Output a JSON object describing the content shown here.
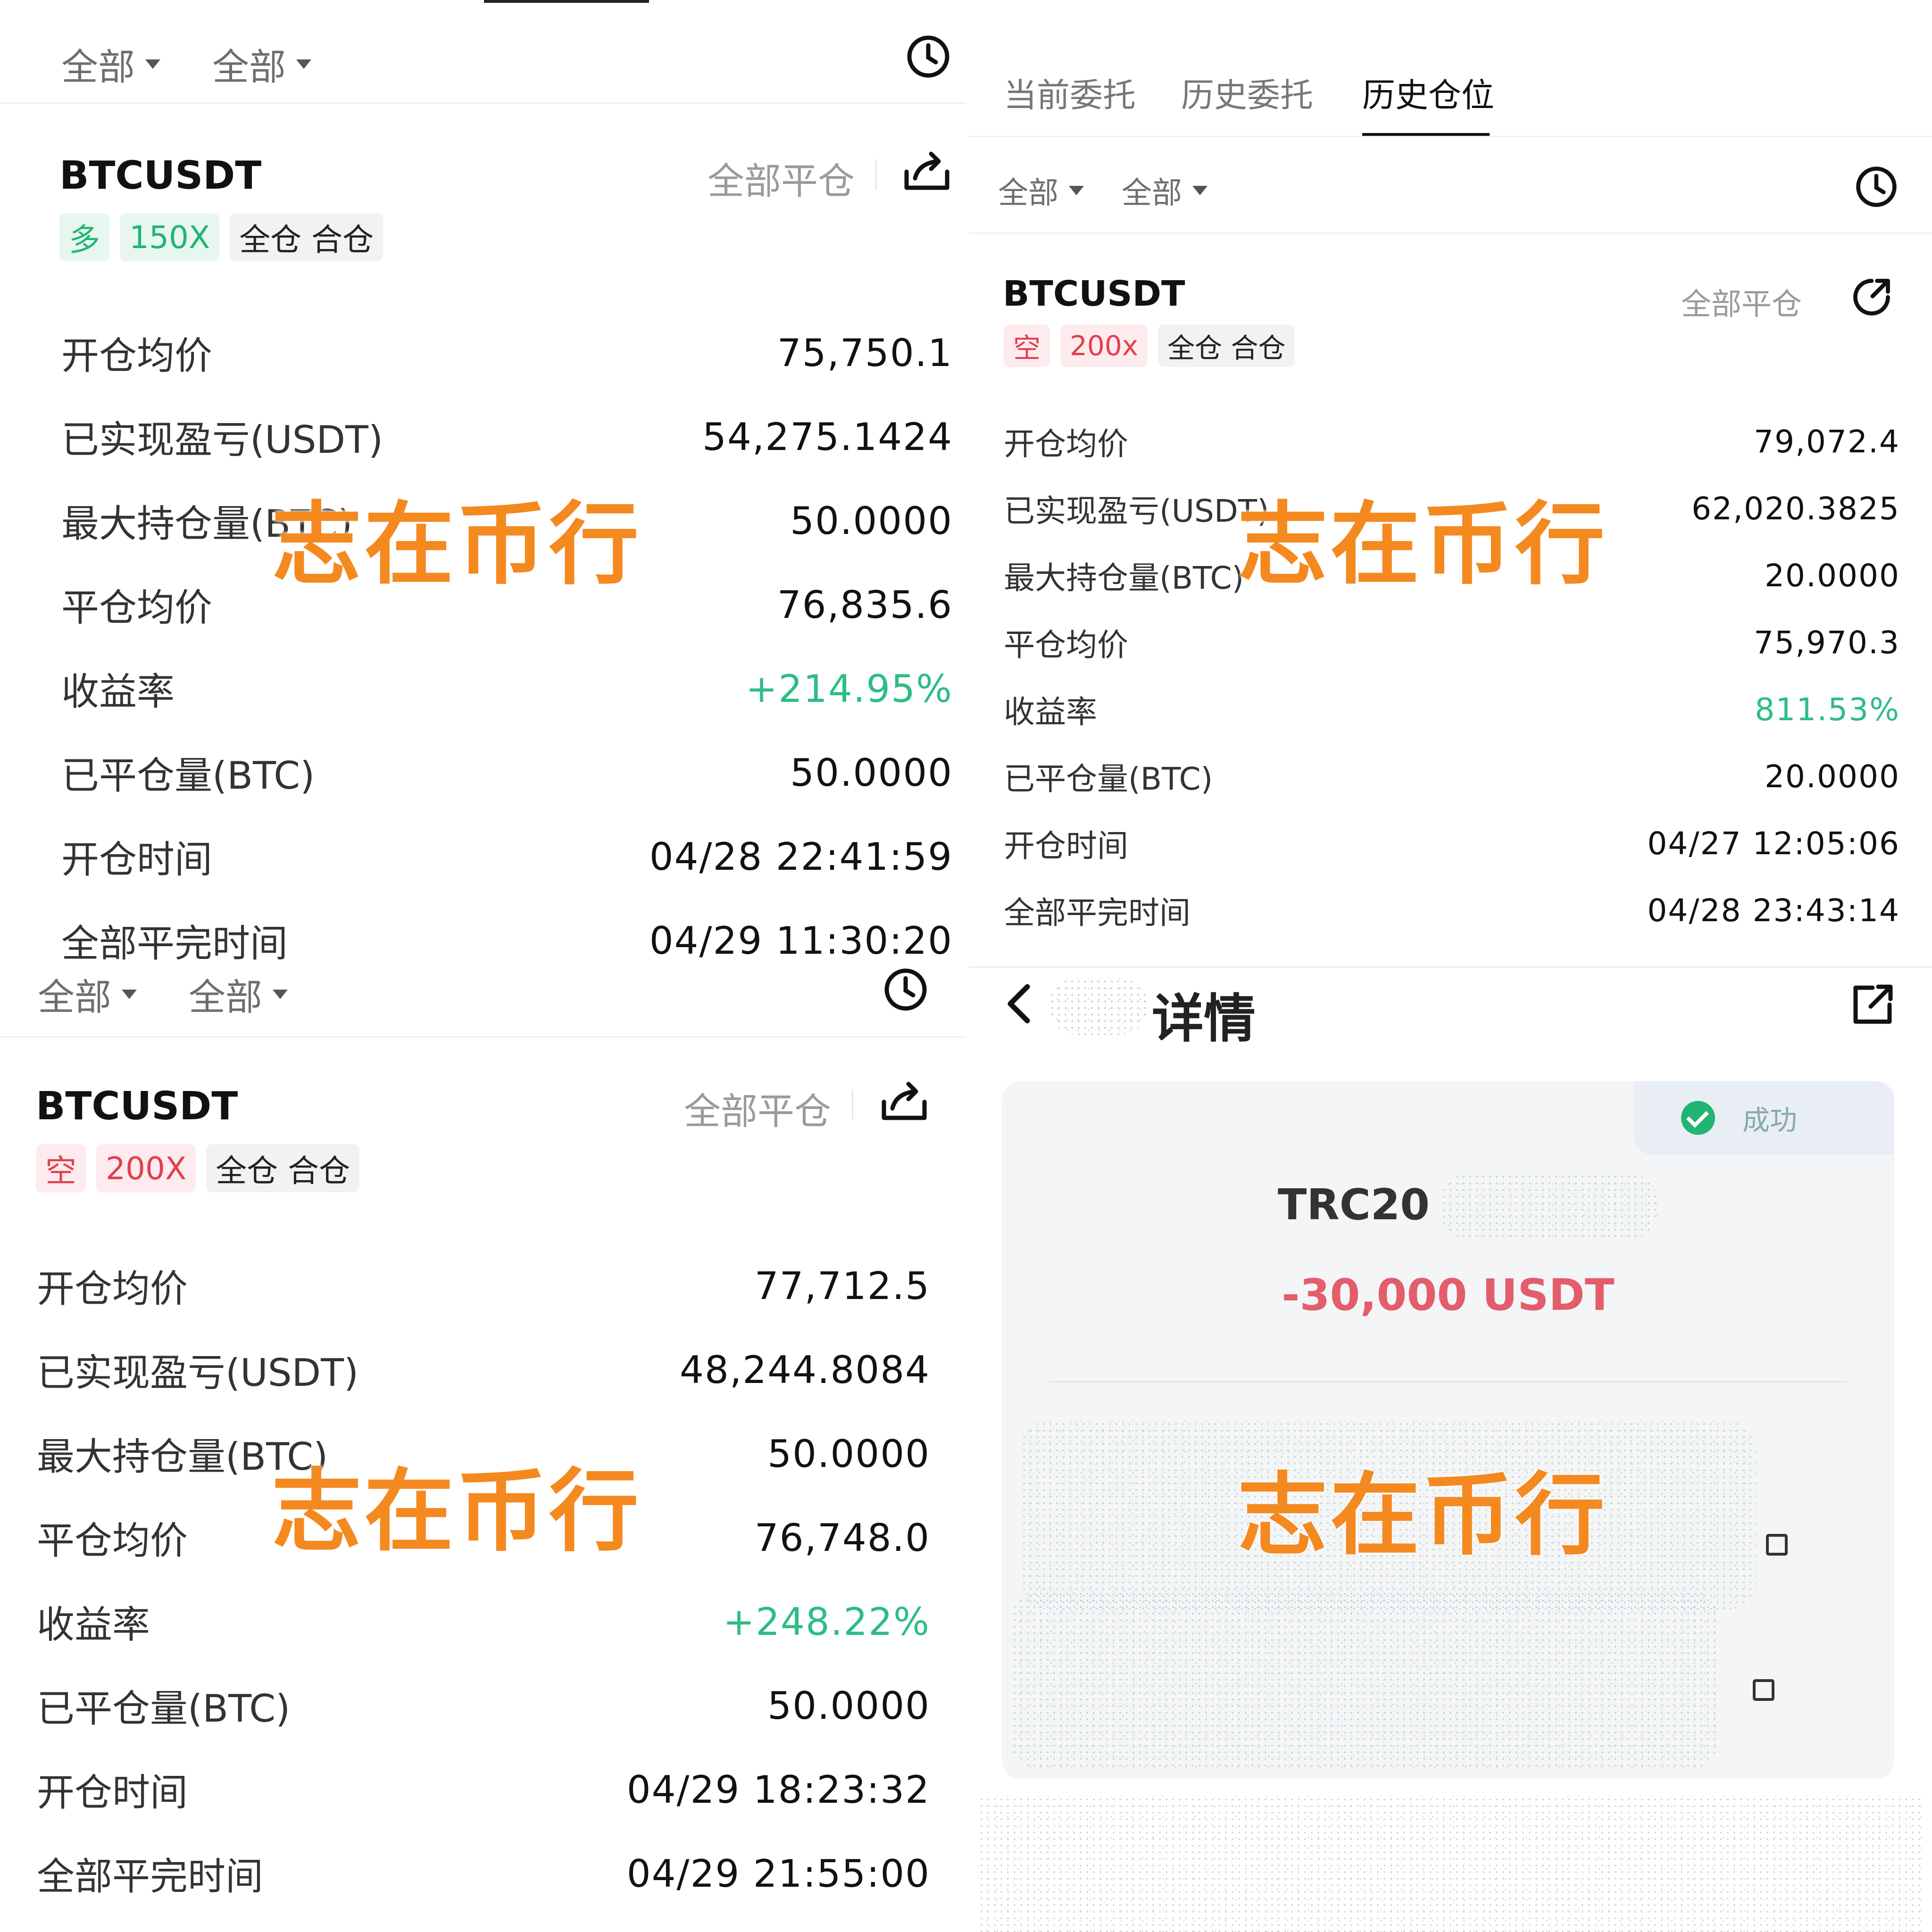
{
  "watermark": "志在币行",
  "panel1": {
    "filters": [
      "全部",
      "全部"
    ],
    "symbol": "BTCUSDT",
    "close_all": "全部平仓",
    "tags": [
      "多",
      "150X",
      "全仓 合仓"
    ],
    "rows": [
      {
        "label": "开仓均价",
        "value": "75,750.1"
      },
      {
        "label": "已实现盈亏(USDT)",
        "value": "54,275.1424"
      },
      {
        "label": "最大持仓量(BTC)",
        "value": "50.0000"
      },
      {
        "label": "平仓均价",
        "value": "76,835.6"
      },
      {
        "label": "收益率",
        "value": "+214.95%"
      },
      {
        "label": "已平仓量(BTC)",
        "value": "50.0000"
      },
      {
        "label": "开仓时间",
        "value": "04/28 22:41:59"
      },
      {
        "label": "全部平完时间",
        "value": "04/29 11:30:20"
      }
    ]
  },
  "panel2": {
    "tabs": [
      "当前委托",
      "历史委托",
      "历史仓位"
    ],
    "filters": [
      "全部",
      "全部"
    ],
    "symbol": "BTCUSDT",
    "close_all": "全部平仓",
    "tags": [
      "空",
      "200x",
      "全仓 合仓"
    ],
    "rows": [
      {
        "label": "开仓均价",
        "value": "79,072.4"
      },
      {
        "label": "已实现盈亏(USDT)",
        "value": "62,020.3825"
      },
      {
        "label": "最大持仓量(BTC)",
        "value": "20.0000"
      },
      {
        "label": "平仓均价",
        "value": "75,970.3"
      },
      {
        "label": "收益率",
        "value": "811.53%"
      },
      {
        "label": "已平仓量(BTC)",
        "value": "20.0000"
      },
      {
        "label": "开仓时间",
        "value": "04/27 12:05:06"
      },
      {
        "label": "全部平完时间",
        "value": "04/28 23:43:14"
      }
    ]
  },
  "panel3": {
    "filters": [
      "全部",
      "全部"
    ],
    "symbol": "BTCUSDT",
    "close_all": "全部平仓",
    "tags": [
      "空",
      "200X",
      "全仓 合仓"
    ],
    "rows": [
      {
        "label": "开仓均价",
        "value": "77,712.5"
      },
      {
        "label": "已实现盈亏(USDT)",
        "value": "48,244.8084"
      },
      {
        "label": "最大持仓量(BTC)",
        "value": "50.0000"
      },
      {
        "label": "平仓均价",
        "value": "76,748.0"
      },
      {
        "label": "收益率",
        "value": "+248.22%"
      },
      {
        "label": "已平仓量(BTC)",
        "value": "50.0000"
      },
      {
        "label": "开仓时间",
        "value": "04/29 18:23:32"
      },
      {
        "label": "全部平完时间",
        "value": "04/29 21:55:00"
      }
    ]
  },
  "panel4": {
    "title": "详情",
    "status": "成功",
    "transfer_title": "TRC20",
    "amount": "-30,000 USDT"
  },
  "colors": {
    "positive": "#2dbd85",
    "long_tag": "#21b573",
    "short_tag": "#e0404e",
    "amount": "#e35d6a",
    "watermark": "#f4891f"
  }
}
